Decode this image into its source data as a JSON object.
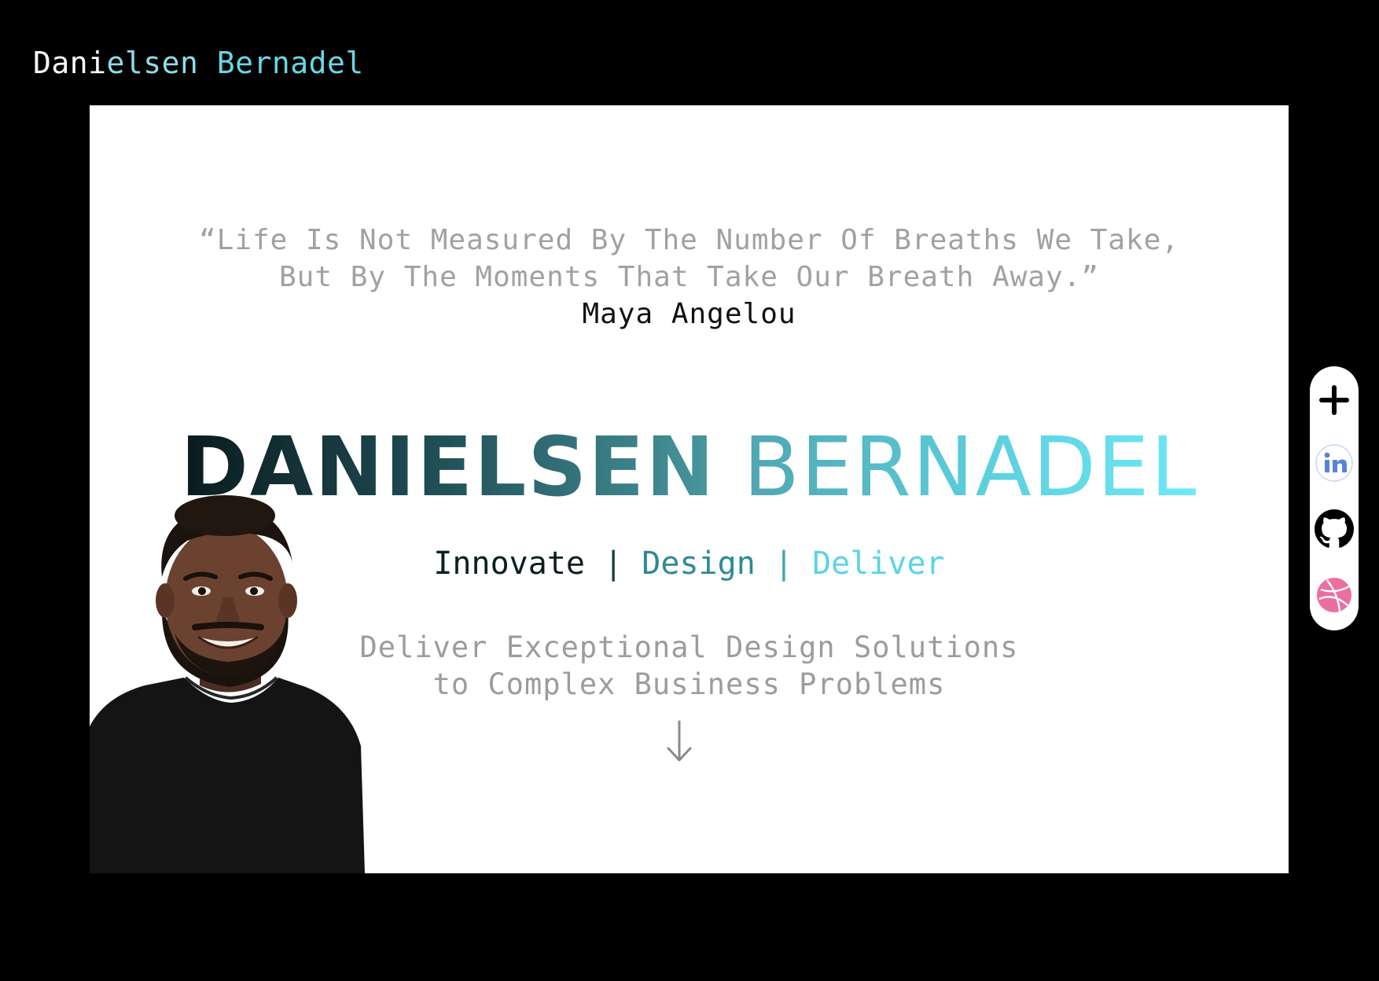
{
  "header": {
    "brand_part1": "Dani",
    "brand_part2": "elsen",
    "brand_part3": " Bernadel"
  },
  "hero": {
    "quote_line1": "“Life Is Not Measured By The Number Of Breaths We Take,",
    "quote_line2": "But By The Moments That Take Our Breath Away.”",
    "quote_author": "Maya Angelou",
    "name_first": "DANIELSEN",
    "name_last": "BERNADEL",
    "tagline": {
      "word1": "Innovate",
      "separator": "|",
      "word2": "Design",
      "word3": "Deliver"
    },
    "subtitle_line1": "Deliver Exceptional Design Solutions",
    "subtitle_line2": "to Complex Business Problems",
    "scroll_icon": "arrow-down-icon",
    "portrait_icon": "profile-photo"
  },
  "social": {
    "items": [
      {
        "icon": "plus-icon",
        "color": "#000000"
      },
      {
        "icon": "linkedin-icon",
        "color": "#5a83d6"
      },
      {
        "icon": "github-icon",
        "color": "#000000"
      },
      {
        "icon": "dribbble-icon",
        "color": "#ea6fa0"
      }
    ]
  },
  "colors": {
    "background": "#000000",
    "card": "#ffffff",
    "accent": "#5dd0de",
    "accent_dark": "#1e4b52",
    "muted_text": "#a1a1a1"
  }
}
